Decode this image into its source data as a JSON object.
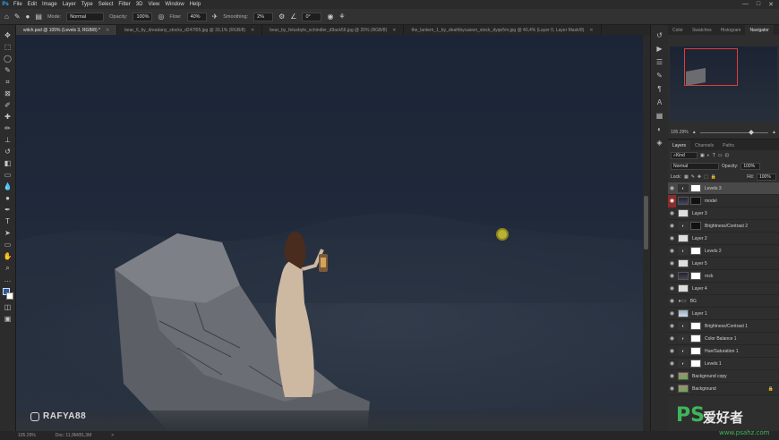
{
  "menubar": {
    "app_icon": "Ps",
    "items": [
      "File",
      "Edit",
      "Image",
      "Layer",
      "Type",
      "Select",
      "Filter",
      "3D",
      "View",
      "Window",
      "Help"
    ],
    "window_controls": [
      "—",
      "□",
      "✕"
    ]
  },
  "options": {
    "mode_label": "Mode:",
    "mode_value": "Normal",
    "opacity_label": "Opacity:",
    "opacity_value": "100%",
    "flow_label": "Flow:",
    "flow_value": "40%",
    "smoothing_label": "Smoothing:",
    "smoothing_value": "2%",
    "angle_value": "0°"
  },
  "tabs": [
    {
      "label": "witch.psd @ 105% (Levels 3, RGB/8) *",
      "active": true
    },
    {
      "label": "bear_6_by_dreadany_stocks_d247f05.jpg @ 33,1% (RGB/8)",
      "active": false
    },
    {
      "label": "bear_by_fetusbyle_schindler_d9ack56.jpg @ 25% (RGB/8)",
      "active": false
    },
    {
      "label": "the_lantern_1_by_deathbycasion_stock_dyqe5m.jpg @ 40,4% (Layer 0, Layer Mask/8)",
      "active": false
    }
  ],
  "canvas": {
    "watermark": "RAFYA88"
  },
  "status": {
    "zoom": "105.29%",
    "doc": "Doc: 11,9M/81,3M",
    "arrow": ">"
  },
  "navigator": {
    "tabs": [
      "Color",
      "Swatches",
      "Histogram",
      "Navigator"
    ],
    "active_tab": "Navigator",
    "zoom": "105.29%"
  },
  "layers_panel": {
    "tabs": [
      "Layers",
      "Channels",
      "Paths"
    ],
    "active_tab": "Layers",
    "filter_label": "Kind",
    "blend_mode": "Normal",
    "opacity_label": "Opacity:",
    "opacity_value": "100%",
    "lock_label": "Lock:",
    "fill_label": "Fill:",
    "fill_value": "100%",
    "layers": [
      {
        "name": "Levels 3",
        "kind": "adj",
        "mask": "white",
        "selected": true,
        "eye": "normal"
      },
      {
        "name": "model",
        "kind": "img",
        "mask": "dark",
        "selected": false,
        "eye": "red"
      },
      {
        "name": "Layer 3",
        "kind": "blank",
        "mask": "",
        "selected": false,
        "eye": "normal"
      },
      {
        "name": "Brightness/Contrast 2",
        "kind": "adj",
        "mask": "dark",
        "selected": false,
        "eye": "normal"
      },
      {
        "name": "Layer 2",
        "kind": "blank",
        "mask": "",
        "selected": false,
        "eye": "normal"
      },
      {
        "name": "Levels 2",
        "kind": "adj",
        "mask": "white",
        "selected": false,
        "eye": "normal"
      },
      {
        "name": "Layer 5",
        "kind": "blank",
        "mask": "",
        "selected": false,
        "eye": "normal"
      },
      {
        "name": "rock",
        "kind": "img",
        "mask": "white",
        "selected": false,
        "eye": "normal"
      },
      {
        "name": "Layer 4",
        "kind": "blank",
        "mask": "",
        "selected": false,
        "eye": "normal"
      },
      {
        "name": "BG",
        "kind": "folder",
        "mask": "",
        "selected": false,
        "eye": "normal"
      },
      {
        "name": "Layer 1",
        "kind": "sky",
        "mask": "",
        "selected": false,
        "eye": "normal"
      },
      {
        "name": "Brightness/Contrast 1",
        "kind": "adj",
        "mask": "white",
        "selected": false,
        "eye": "normal"
      },
      {
        "name": "Color Balance 1",
        "kind": "adj",
        "mask": "white",
        "selected": false,
        "eye": "normal"
      },
      {
        "name": "Hue/Saturation 1",
        "kind": "adj",
        "mask": "white",
        "selected": false,
        "eye": "normal"
      },
      {
        "name": "Levels 1",
        "kind": "adj",
        "mask": "white",
        "selected": false,
        "eye": "normal"
      },
      {
        "name": "Background copy",
        "kind": "bgimg",
        "mask": "",
        "selected": false,
        "eye": "normal"
      },
      {
        "name": "Background",
        "kind": "bgimg",
        "mask": "",
        "selected": false,
        "eye": "normal",
        "locked": true
      }
    ]
  },
  "logo": {
    "ps": "PS",
    "cn": "爱好者",
    "url": "www.psahz.com"
  }
}
